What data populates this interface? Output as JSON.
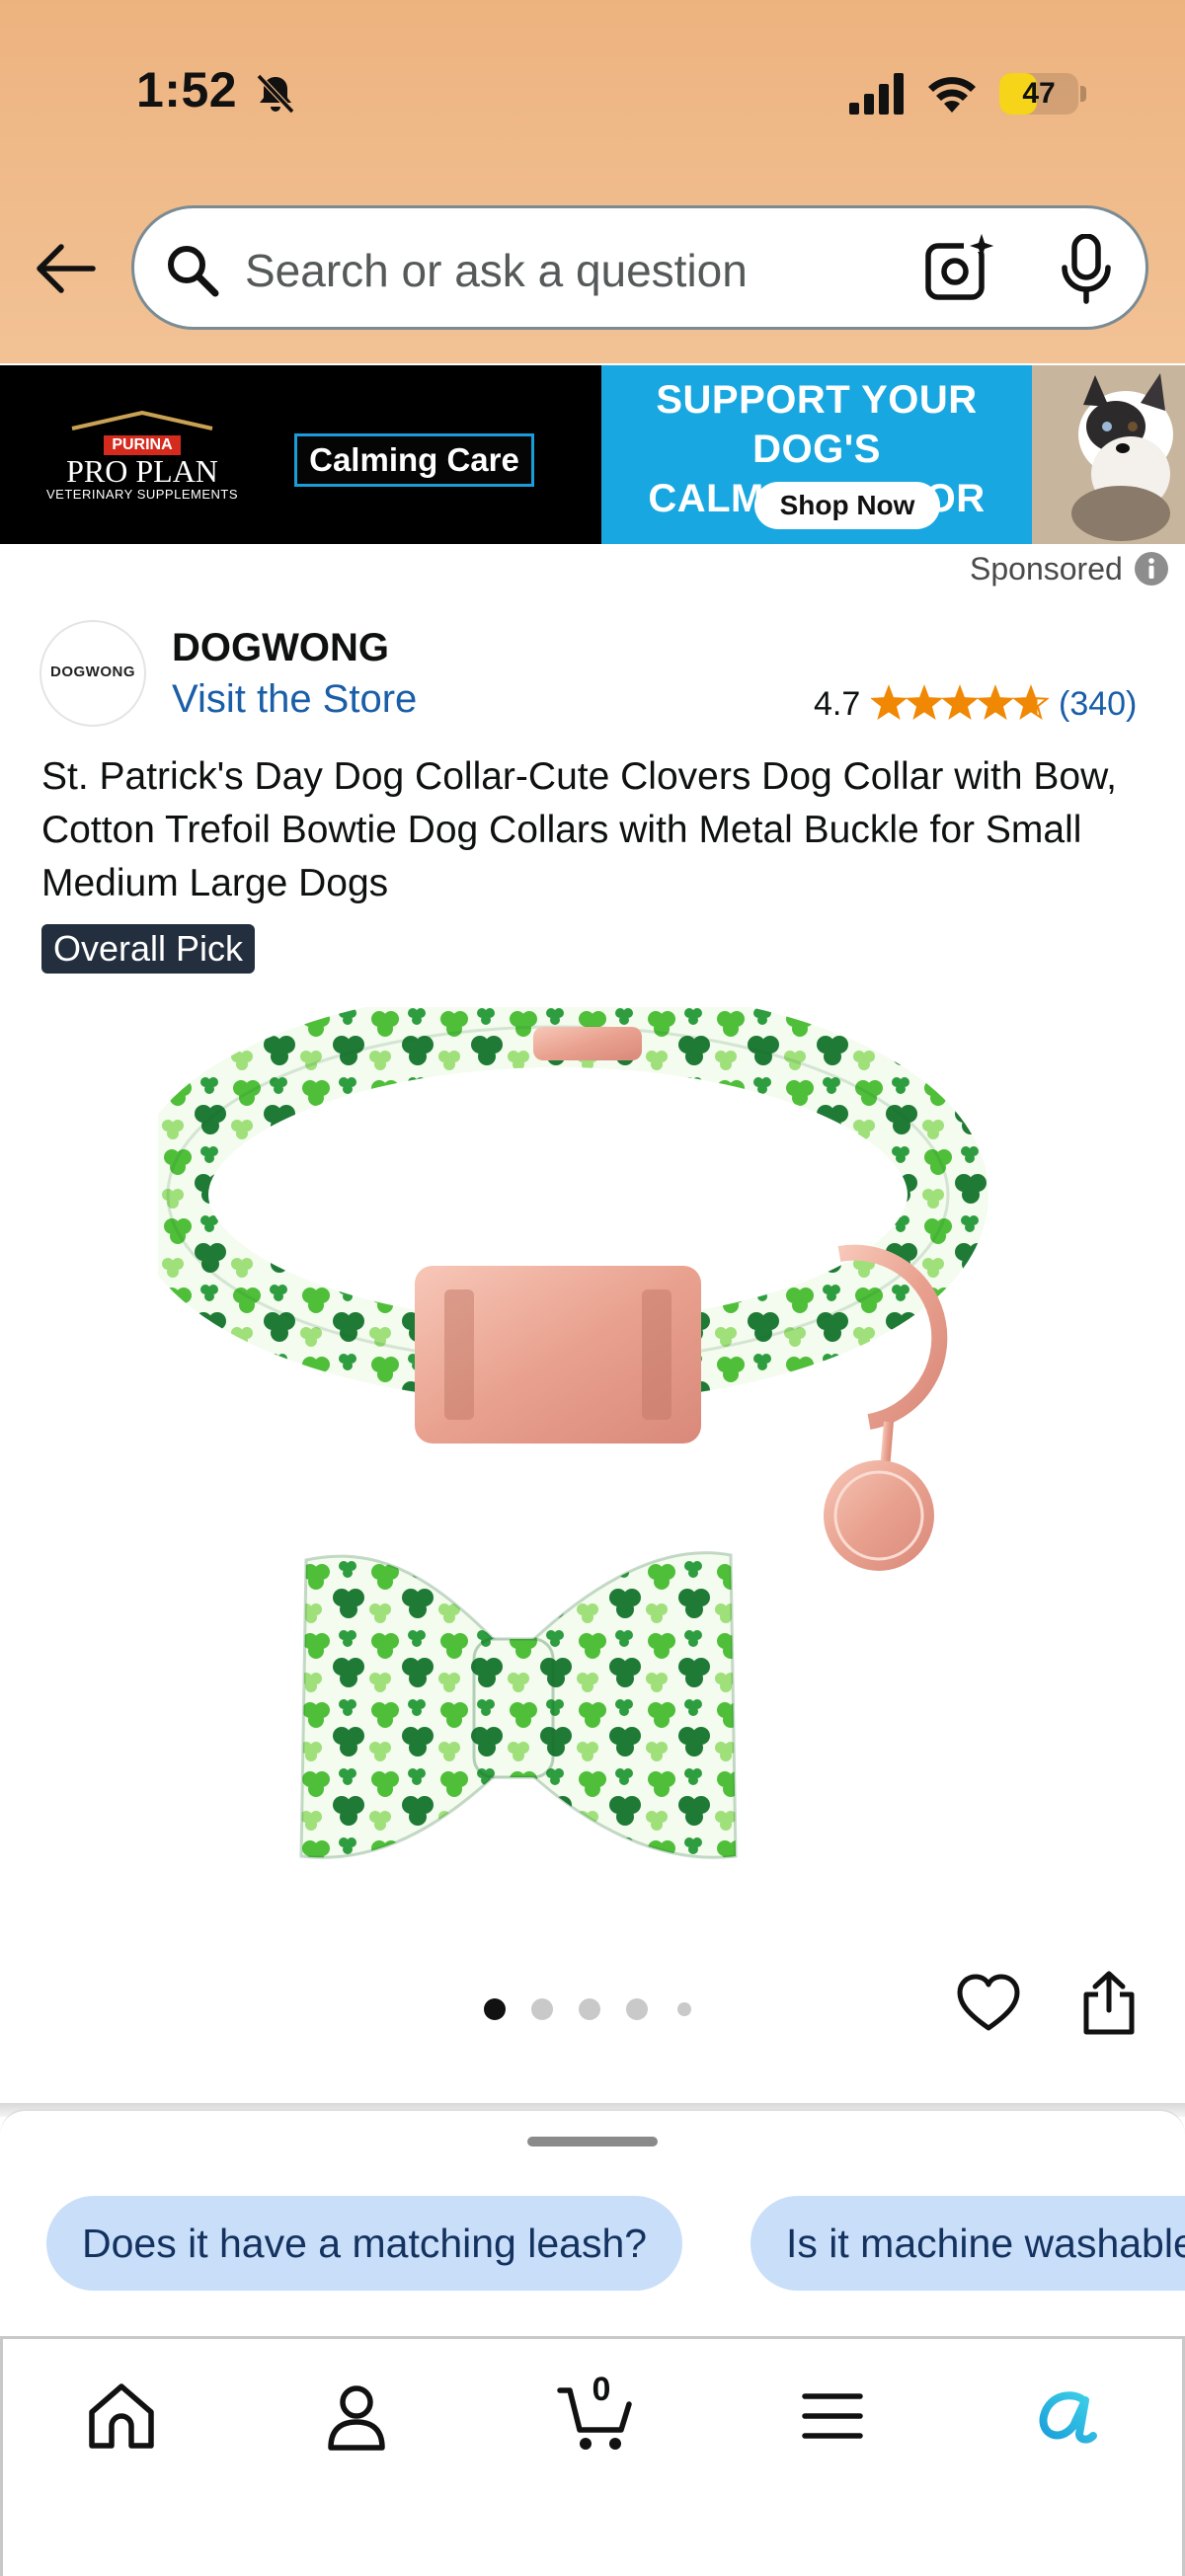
{
  "status_bar": {
    "time": "1:52",
    "battery": "47",
    "battery_level": 0.47
  },
  "search": {
    "placeholder": "Search or ask a question"
  },
  "ad": {
    "brand_badge": "PURINA",
    "brand_name": "PRO PLAN",
    "brand_sub": "VETERINARY SUPPLEMENTS",
    "product": "Calming Care",
    "headline_line1": "SUPPORT YOUR DOG'S",
    "headline_line2": "CALM BEHAVIOR",
    "cta": "Shop Now",
    "sponsored_label": "Sponsored"
  },
  "brand": {
    "logo_text": "DOGWONG",
    "name": "DOGWONG",
    "store_link": "Visit the Store",
    "rating": "4.7",
    "rating_value": 4.7,
    "rating_count": "(340)"
  },
  "product": {
    "title": "St. Patrick's Day Dog Collar-Cute Clovers Dog Collar with Bow, Cotton Trefoil Bowtie Dog Collars with Metal Buckle for Small Medium Large Dogs",
    "badge": "Overall Pick",
    "image_count": 5,
    "active_image": 1
  },
  "questions": [
    "Does it have a matching leash?",
    "Is it machine washable?"
  ],
  "tabbar": {
    "cart_count": "0",
    "tabs": [
      "home-icon",
      "account-icon",
      "cart-icon",
      "menu-icon",
      "rufus-icon"
    ]
  },
  "colors": {
    "header": "#edb37f",
    "link": "#1a5ea8",
    "star": "#f08804",
    "chip": "#c9def8",
    "badge": "#232f3e",
    "ad_blue": "#18a7e0",
    "rufus": "#1a9ed9"
  }
}
